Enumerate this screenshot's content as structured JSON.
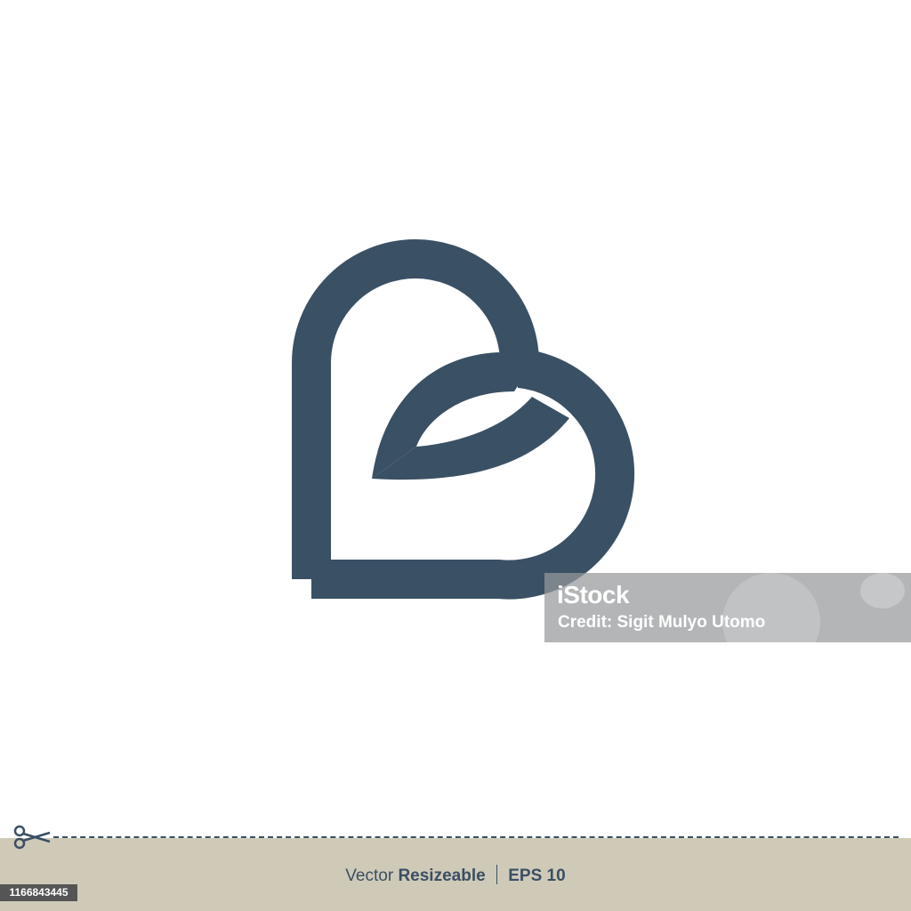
{
  "logo": {
    "color": "#3a5064",
    "icon": "heart-letter-b-leaf-logo"
  },
  "watermark": {
    "brand": "iStock",
    "credit": "Credit: Sigit Mulyo Utomo"
  },
  "footer": {
    "background": "#cfcab8",
    "text_regular": "Vector",
    "text_bold": "Resizeable",
    "text_format": "EPS 10",
    "icon": "scissors-icon"
  },
  "stock_id": "1166843445"
}
